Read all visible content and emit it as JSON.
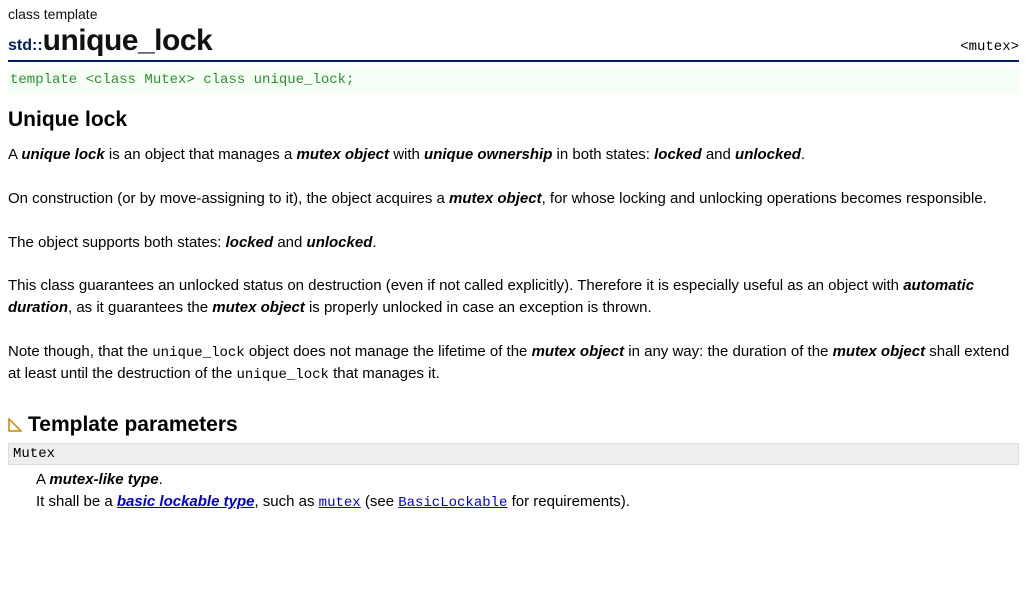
{
  "kind": "class template",
  "ns": "std::",
  "name": "unique_lock",
  "header_tag": "<mutex>",
  "signature": "template <class Mutex> class unique_lock;",
  "section_title": "Unique lock",
  "p1": {
    "t0": "A ",
    "b0": "unique lock",
    "t1": " is an object that manages a ",
    "b1": "mutex object",
    "t2": " with ",
    "b2": "unique ownership",
    "t3": " in both states: ",
    "b3": "locked",
    "t4": " and ",
    "b4": "unlocked",
    "t5": "."
  },
  "p2": {
    "t0": "On construction (or by move-assigning to it), the object acquires a ",
    "b0": "mutex object",
    "t1": ", for whose locking and unlocking operations becomes responsible."
  },
  "p3": {
    "t0": "The object supports both states: ",
    "b0": "locked",
    "t1": " and ",
    "b1": "unlocked",
    "t2": "."
  },
  "p4": {
    "t0": "This class guarantees an unlocked status on destruction (even if not called explicitly). Therefore it is especially useful as an object with ",
    "b0": "automatic duration",
    "t1": ", as it guarantees the ",
    "b1": "mutex object",
    "t2": " is properly unlocked in case an exception is thrown."
  },
  "p5": {
    "t0": "Note though, that the ",
    "c0": "unique_lock",
    "t1": " object does not manage the lifetime of the ",
    "b0": "mutex object",
    "t2": " in any way: the duration of the ",
    "b1": "mutex object",
    "t3": " shall extend at least until the destruction of the ",
    "c1": "unique_lock",
    "t4": " that manages it."
  },
  "tp_heading": "Template parameters",
  "param": {
    "name": "Mutex",
    "l1a": "A ",
    "l1b": "mutex-like type",
    "l1c": ".",
    "l2a": "It shall be a ",
    "link_basic_lockable_type": "basic lockable type",
    "l2b": ", such as ",
    "link_mutex": "mutex",
    "l2c": " (see ",
    "link_BasicLockable": "BasicLockable",
    "l2d": " for requirements)."
  }
}
